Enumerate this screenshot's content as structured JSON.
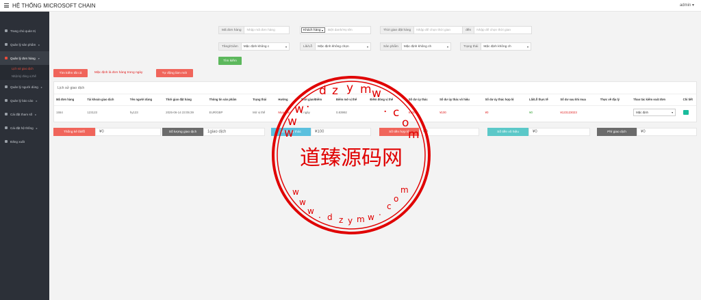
{
  "app": {
    "title": "HỆ THỐNG MICROSOFT CHAIN",
    "user": "admin"
  },
  "sidebar": {
    "items": [
      {
        "label": "Trang chủ quản trị",
        "arrow": ""
      },
      {
        "label": "Quản lý sản phẩm",
        "arrow": "▸"
      },
      {
        "label": "Quản lý đơn hàng",
        "arrow": "▾"
      },
      {
        "label": "Quản lý người dùng",
        "arrow": "▸"
      },
      {
        "label": "Quản lý báo cáo",
        "arrow": "▸"
      },
      {
        "label": "Cài đặt tham số",
        "arrow": "▸"
      },
      {
        "label": "Cài đặt hệ thống",
        "arrow": "▸"
      },
      {
        "label": "Đăng xuất",
        "arrow": ""
      }
    ],
    "subitems": [
      "Lịch sử giao dịch",
      "Nhật ký đóng vị thế"
    ]
  },
  "filters": {
    "order_no": {
      "label": "Mã đơn hàng",
      "placeholder": "Nhập mã đơn hàng"
    },
    "customer": {
      "select": "Khách hàng",
      "placeholder": "Biệt danh/Họ tên"
    },
    "time": {
      "label": "Thời gian đặt hàng",
      "placeholder_from": "Nhập để chọn thời gian",
      "to": "đến",
      "placeholder_to": "Nhập để chọn thời gian"
    },
    "direction": {
      "label": "Tăng/Giảm",
      "value": "Mặc định không c"
    },
    "profit": {
      "label": "Lãi/Lỗ",
      "value": "Mặc định không chọn"
    },
    "product": {
      "label": "Sản phẩm",
      "value": "Mặc định không ch"
    },
    "status": {
      "label": "Trạng thái",
      "value": "Mặc định không ch"
    },
    "search_button": "Tìm kiếm"
  },
  "actions": {
    "search_all": "Tìm kiếm tất cả",
    "default_note": "Mặc định là đơn hàng trong ngày",
    "auto_refresh": "Tự động làm mới"
  },
  "table": {
    "title": "Lịch sử giao dịch",
    "headers": [
      "Mã đơn hàng",
      "Tài khoản giao dịch",
      "Tên người dùng",
      "Thời gian đặt hàng",
      "Thông tin sản phẩm",
      "Trạng thái",
      "Hướng",
      "Thời gian/Điểm",
      "Điểm mở vị thế",
      "Điểm đóng vị thế",
      "Số dư ủy thác",
      "Số dư ủy thác vô hiệu",
      "Số dư ủy thác hợp lệ",
      "Lãi/Lỗ thực tế",
      "Số dư sau khi mua",
      "Thực về địa lý",
      "Thao tác kiểm soát đơn",
      "Chi tiết"
    ],
    "rows": [
      [
        "1554",
        "123123",
        "hy123",
        "2025-06-14 23:05:39",
        "EUR/GBP",
        "Mở vị thế",
        "Mua tăng",
        "1 ngày",
        "0.83992",
        "",
        "¥100",
        "¥100",
        "¥0",
        "¥0",
        "¥123123023",
        "",
        "Mặc định",
        ""
      ]
    ]
  },
  "stats": [
    {
      "label": "Thống kê lãi/lỗ",
      "value": "¥0",
      "color": "#f0655b"
    },
    {
      "label": "Số lượng giao dịch",
      "value": "1giao dịch",
      "color": "#6b6b6b"
    },
    {
      "label": "Số dư ủy thác",
      "value": "¥100",
      "color": "#5bc0de"
    },
    {
      "label": "Số tiền hợp lệ",
      "value": "¥0",
      "color": "#f0655b"
    },
    {
      "label": "Số tiền vô hiệu",
      "value": "¥0",
      "color": "#5bc8c8"
    },
    {
      "label": "Phí giao dịch",
      "value": "¥0",
      "color": "#6b6b6b"
    }
  ],
  "watermark": {
    "top_text": "dzymw.com",
    "center_text": "道臻源码网",
    "bottom_text": "www.dzymw.com"
  },
  "colors": {
    "sidebar": "#2c3038",
    "accent_red": "#f0655b",
    "green": "#5cb85c",
    "watermark": "#e00000"
  }
}
